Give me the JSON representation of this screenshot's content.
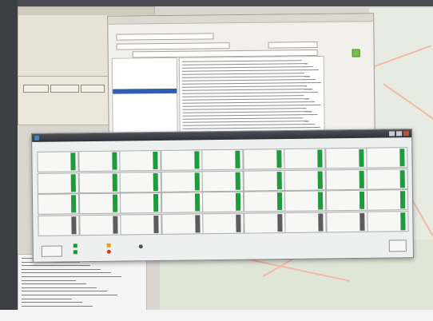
{
  "status_window": {
    "title": "",
    "menu": [],
    "tiles": [
      {
        "label": "",
        "state": "ok"
      },
      {
        "label": "",
        "state": "ok"
      },
      {
        "label": "",
        "state": "ok"
      },
      {
        "label": "",
        "state": "ok"
      },
      {
        "label": "",
        "state": "ok"
      },
      {
        "label": "",
        "state": "ok"
      },
      {
        "label": "",
        "state": "ok"
      },
      {
        "label": "",
        "state": "ok"
      },
      {
        "label": "",
        "state": "ok"
      },
      {
        "label": "",
        "state": "ok"
      },
      {
        "label": "",
        "state": "ok"
      },
      {
        "label": "",
        "state": "ok"
      },
      {
        "label": "",
        "state": "ok"
      },
      {
        "label": "",
        "state": "ok"
      },
      {
        "label": "",
        "state": "ok"
      },
      {
        "label": "",
        "state": "ok"
      },
      {
        "label": "",
        "state": "ok"
      },
      {
        "label": "",
        "state": "ok"
      },
      {
        "label": "",
        "state": "ok"
      },
      {
        "label": "",
        "state": "ok"
      },
      {
        "label": "",
        "state": "ok"
      },
      {
        "label": "",
        "state": "ok"
      },
      {
        "label": "",
        "state": "ok"
      },
      {
        "label": "",
        "state": "ok"
      },
      {
        "label": "",
        "state": "ok"
      },
      {
        "label": "",
        "state": "ok"
      },
      {
        "label": "",
        "state": "ok"
      },
      {
        "label": "",
        "state": "idle"
      },
      {
        "label": "",
        "state": "idle"
      },
      {
        "label": "",
        "state": "idle"
      },
      {
        "label": "",
        "state": "idle"
      },
      {
        "label": "",
        "state": "idle"
      },
      {
        "label": "",
        "state": "idle"
      },
      {
        "label": "",
        "state": "idle"
      },
      {
        "label": "",
        "state": "idle"
      },
      {
        "label": "",
        "state": "ok"
      }
    ],
    "exit_label": "",
    "legend": [
      {
        "label": "",
        "color": "#1f9a3c"
      },
      {
        "label": "",
        "color": "#e3a21a"
      },
      {
        "label": "",
        "color": "#4a4d51"
      },
      {
        "label": "",
        "color": "#1f9a3c"
      },
      {
        "label": "",
        "color": "#c83a2b"
      }
    ],
    "corner_button_label": "",
    "colors": {
      "ok": "#1f9a3c",
      "idle": "#5a5c5e"
    }
  }
}
